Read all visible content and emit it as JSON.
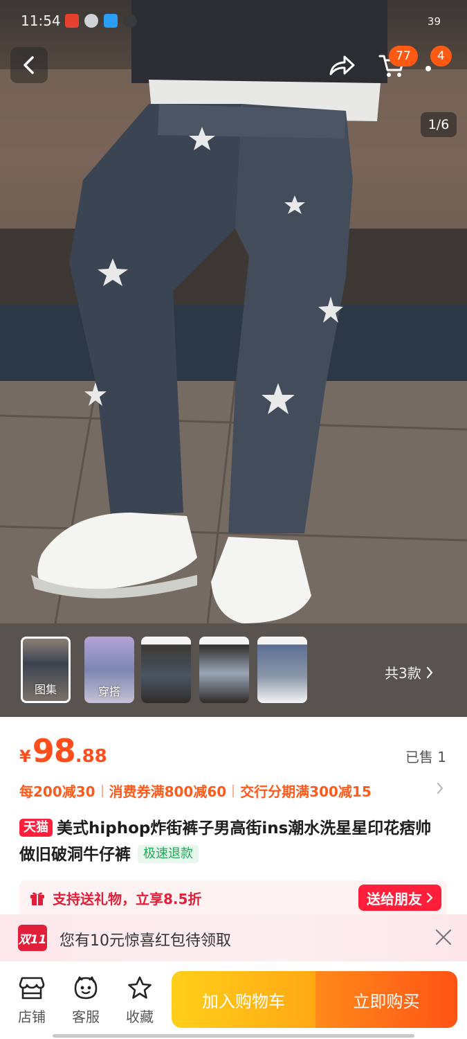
{
  "status_bar": {
    "time": "11:54",
    "battery": "39"
  },
  "header": {
    "back_icon": "chevron-left-icon",
    "share_icon": "share-arrow-icon",
    "cart_icon": "cart-icon",
    "cart_badge": "77",
    "more_badge": "4"
  },
  "gallery": {
    "pager": "1/6",
    "thumbs": [
      {
        "label": "图集"
      },
      {
        "label": "穿搭"
      },
      {
        "label": ""
      },
      {
        "label": ""
      },
      {
        "label": ""
      }
    ],
    "variant_count": "共3款"
  },
  "product": {
    "currency": "¥",
    "price_int": "98",
    "price_dec": ".88",
    "sold": "已售 1",
    "promos": [
      "每200减30",
      "消费券满800减60",
      "交行分期满300减15"
    ],
    "tmall_tag": "天猫",
    "title": "美式hiphop炸街裤子男高街ins潮水洗星星印花痞帅做旧破洞牛仔裤",
    "refund_tag": "极速退款"
  },
  "gift": {
    "text": "支持送礼物，立享8.5折",
    "button": "送给朋友"
  },
  "red_packet": {
    "badge": "双11",
    "text": "您有10元惊喜红包待领取"
  },
  "bottom_bar": {
    "shop": "店铺",
    "service": "客服",
    "favorite": "收藏",
    "add_to_cart": "加入购物车",
    "buy_now": "立即购买"
  },
  "colors": {
    "accent": "#ff4d1c",
    "tmall_red": "#ff1f3a",
    "cart_yellow": "#ffb814",
    "buy_orange": "#ff5316"
  }
}
